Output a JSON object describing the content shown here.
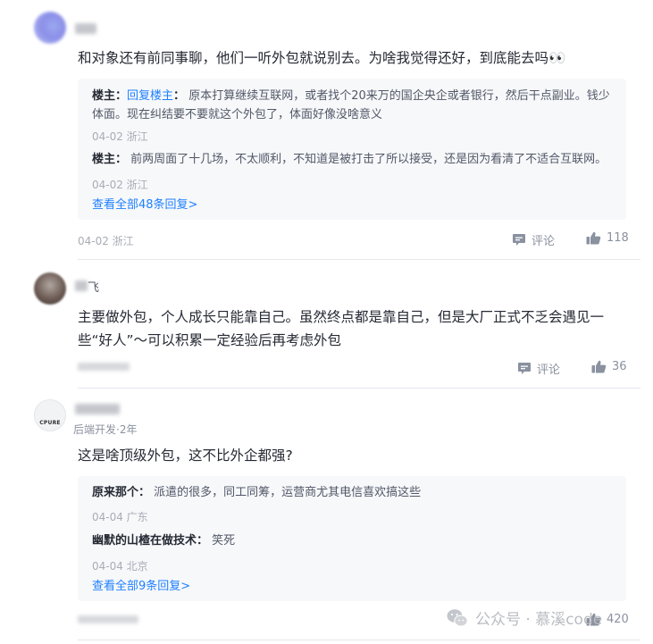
{
  "comments": [
    {
      "content": "和对象还有前同事聊，他们一听外包就说别去。为啥我觉得还好，到底能去吗👀",
      "replies": [
        {
          "author": "楼主",
          "reply_to": "回复楼主",
          "text": "原本打算继续互联网，或者找个20来万的国企央企或者银行，然后干点副业。钱少体面。现在纠结要不要就这个外包了，体面好像没啥意义",
          "meta": "04-02 浙江"
        },
        {
          "author": "楼主",
          "text": "前两周面了十几场，不太顺利，不知道是被打击了所以接受，还是因为看清了不适合互联网。",
          "meta": "04-02 浙江"
        }
      ],
      "view_all": "查看全部48条回复>",
      "date": "04-02 浙江",
      "comment_label": "评论",
      "likes": "118"
    },
    {
      "name_suffix": "飞",
      "content": "主要做外包，个人成长只能靠自己。虽然终点都是靠自己，但是大厂正式不乏会遇见一些“好人”～可以积累一定经验后再考虑外包",
      "comment_label": "评论",
      "likes": "36"
    },
    {
      "avatar_text": "CPURE",
      "title": "后端开发·2年",
      "content": "这是啥顶级外包，这不比外企都强?",
      "replies": [
        {
          "author": "原来那个",
          "text": "派遣的很多，同工同筹，运营商尤其电信喜欢搞这些",
          "meta": "04-04 广东"
        },
        {
          "author": "幽默的山楂在做技术",
          "text": "笑死",
          "meta": "04-04 北京"
        }
      ],
      "view_all": "查看全部9条回复>",
      "likes": "420"
    }
  ],
  "watermark": {
    "text": "公众号 · 慕溪code"
  },
  "colors": {
    "link": "#1e80ff",
    "reply_bg": "#f7f8fa",
    "meta": "#8a919f",
    "text": "#252933"
  }
}
